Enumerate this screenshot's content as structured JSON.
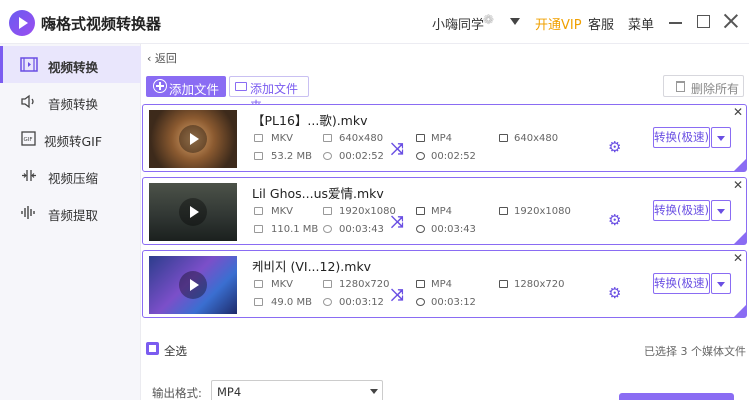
{
  "app": {
    "title": "嗨格式视频转换器"
  },
  "header": {
    "user": "小嗨同学",
    "user_icon": "❁",
    "vip": "开通VIP",
    "service": "客服",
    "menu": "菜单"
  },
  "sidebar": {
    "items": [
      {
        "label": "视频转换",
        "icon": "video-convert-icon",
        "active": true
      },
      {
        "label": "音频转换",
        "icon": "audio-convert-icon",
        "active": false
      },
      {
        "label": "视频转GIF",
        "icon": "gif-icon",
        "active": false
      },
      {
        "label": "视频压缩",
        "icon": "compress-icon",
        "active": false
      },
      {
        "label": "音频提取",
        "icon": "audio-extract-icon",
        "active": false
      }
    ]
  },
  "toolbar": {
    "back": "返回",
    "add_file": "添加文件",
    "add_folder": "添加文件夹",
    "delete_all": "删除所有"
  },
  "files": [
    {
      "name": "【PL16】...歌).mkv",
      "src_format": "MKV",
      "src_res": "640x480",
      "src_size": "53.2 MB",
      "src_duration": "00:02:52",
      "dst_format": "MP4",
      "dst_res": "640x480",
      "dst_duration": "00:02:52",
      "convert": "转换(极速)"
    },
    {
      "name": "Lil Ghos...us爱情.mkv",
      "src_format": "MKV",
      "src_res": "1920x1080",
      "src_size": "110.1 MB",
      "src_duration": "00:03:43",
      "dst_format": "MP4",
      "dst_res": "1920x1080",
      "dst_duration": "00:03:43",
      "convert": "转换(极速)"
    },
    {
      "name": "케비지 (VI...12).mkv",
      "src_format": "MKV",
      "src_res": "1280x720",
      "src_size": "49.0 MB",
      "src_duration": "00:03:12",
      "dst_format": "MP4",
      "dst_res": "1280x720",
      "dst_duration": "00:03:12",
      "convert": "转换(极速)"
    }
  ],
  "footer": {
    "select_all": "全选",
    "selected_info": "已选择 3 个媒体文件",
    "output_label": "输出格式:",
    "output_value": "MP4"
  },
  "colors": {
    "accent": "#8a6cf3",
    "vip": "#f0a000"
  }
}
